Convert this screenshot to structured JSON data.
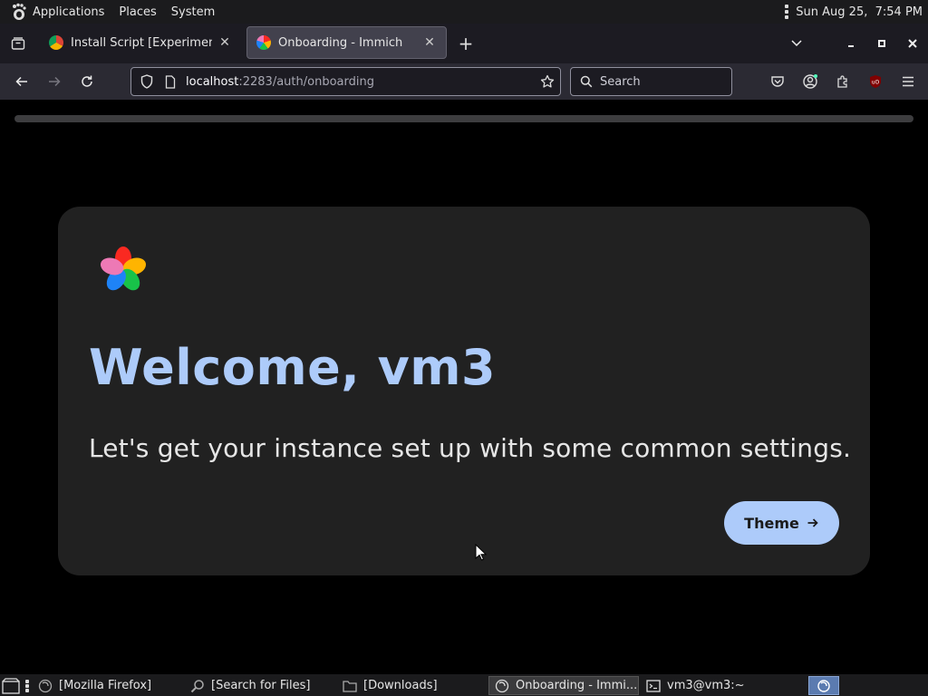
{
  "top_panel": {
    "applications": "Applications",
    "places": "Places",
    "system": "System",
    "clock": "Sun Aug 25,  7:54 PM"
  },
  "tabs": [
    {
      "title": "Install Script [Experimental]",
      "active": false
    },
    {
      "title": "Onboarding - Immich",
      "active": true
    }
  ],
  "nav": {
    "url_host": "localhost",
    "url_path": ":2283/auth/onboarding",
    "search_placeholder": "Search"
  },
  "page": {
    "onboarding_progress": 0,
    "welcome_title": "Welcome, vm3",
    "subtitle": "Let's get your instance set up with some common settings.",
    "next_button": "Theme"
  },
  "taskbar": {
    "items": [
      {
        "label": "[Mozilla Firefox]",
        "icon": "firefox-icon"
      },
      {
        "label": "[Search for Files]",
        "icon": "search-files-icon"
      },
      {
        "label": "[Downloads]",
        "icon": "folder-icon"
      },
      {
        "label": "Onboarding - Immi...",
        "icon": "firefox-icon",
        "active": true
      },
      {
        "label": "vm3@vm3:~",
        "icon": "terminal-icon"
      }
    ]
  },
  "colors": {
    "accent": "#adcbfa",
    "card_bg": "#212121",
    "page_bg": "#000000",
    "toolbar_bg": "#2b2a33",
    "tabstrip_bg": "#1c1b22"
  }
}
